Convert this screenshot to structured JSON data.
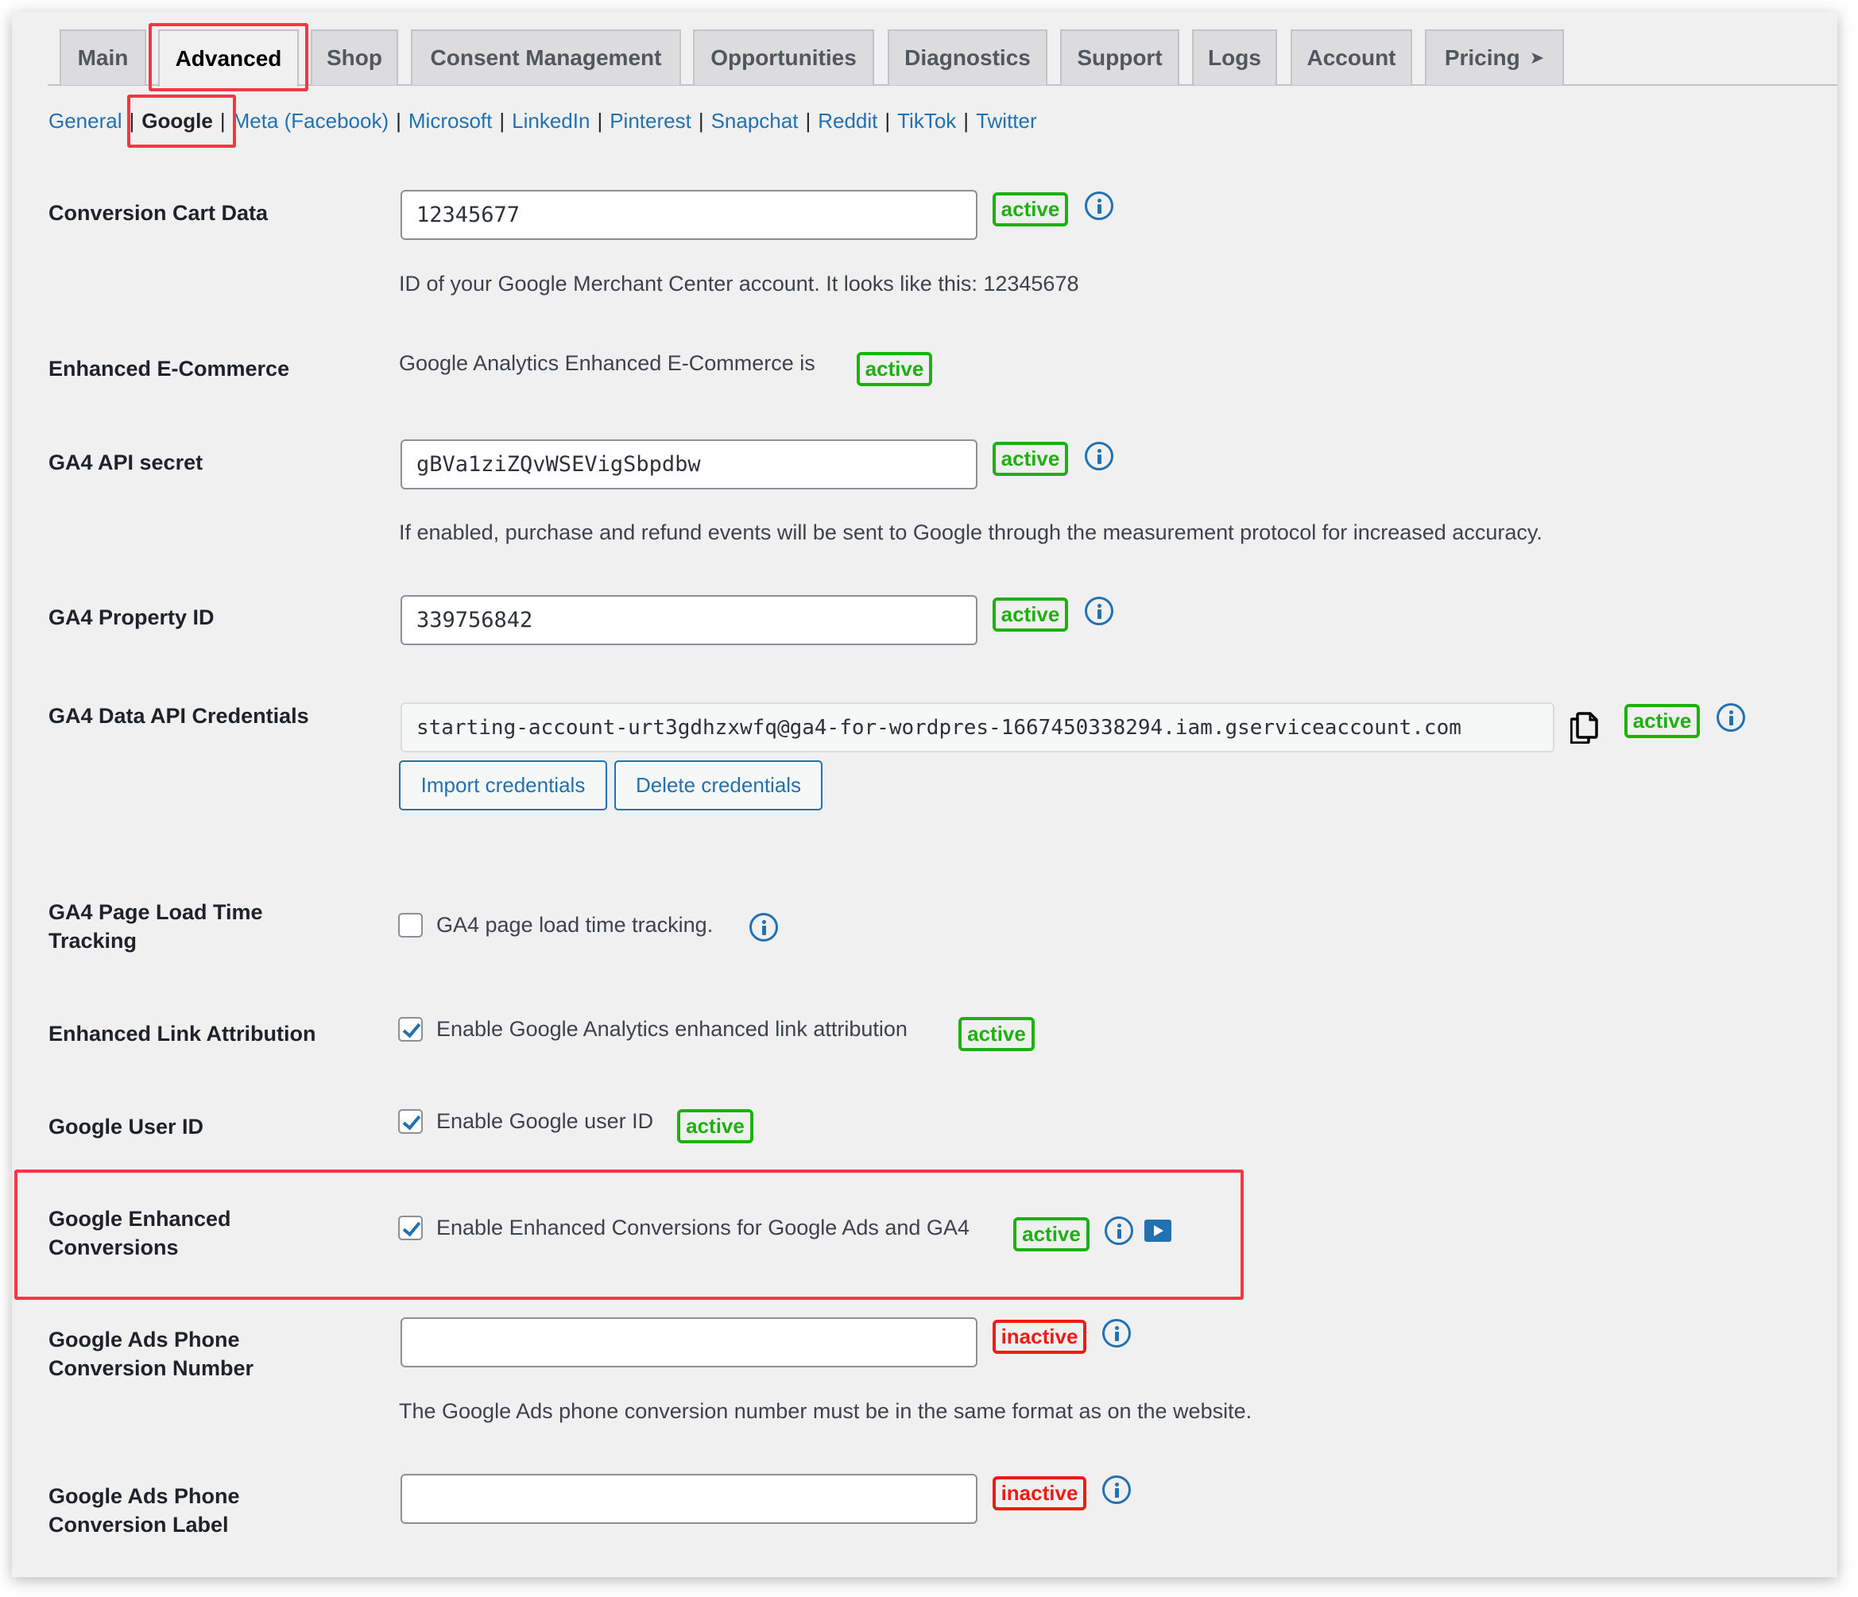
{
  "tabs": [
    {
      "label": "Main",
      "active": false
    },
    {
      "label": "Advanced",
      "active": true
    },
    {
      "label": "Shop",
      "active": false
    },
    {
      "label": "Consent Management",
      "active": false
    },
    {
      "label": "Opportunities",
      "active": false
    },
    {
      "label": "Diagnostics",
      "active": false
    },
    {
      "label": "Support",
      "active": false
    },
    {
      "label": "Logs",
      "active": false
    },
    {
      "label": "Account",
      "active": false
    },
    {
      "label": "Pricing",
      "active": false,
      "icon": "chevron-right-icon",
      "glyph": "➤"
    }
  ],
  "subnav": {
    "separator": "|",
    "items": [
      {
        "label": "General",
        "current": false
      },
      {
        "label": "Google",
        "current": true
      },
      {
        "label": "Meta (Facebook)",
        "current": false
      },
      {
        "label": "Microsoft",
        "current": false
      },
      {
        "label": "LinkedIn",
        "current": false
      },
      {
        "label": "Pinterest",
        "current": false
      },
      {
        "label": "Snapchat",
        "current": false
      },
      {
        "label": "Reddit",
        "current": false
      },
      {
        "label": "TikTok",
        "current": false
      },
      {
        "label": "Twitter",
        "current": false
      }
    ]
  },
  "status": {
    "active": "active",
    "inactive": "inactive",
    "active_color": "#1db10f",
    "inactive_color": "#f01b12"
  },
  "settings": {
    "conversion_cart_data": {
      "label": "Conversion Cart Data",
      "value": "12345677",
      "status": "active",
      "description": "ID of your Google Merchant Center account. It looks like this: 12345678"
    },
    "enhanced_ecommerce": {
      "label": "Enhanced E-Commerce",
      "text": "Google Analytics Enhanced E-Commerce is",
      "status": "active"
    },
    "ga4_api_secret": {
      "label": "GA4 API secret",
      "value": "gBVa1ziZQvWSEVigSbpdbw",
      "status": "active",
      "description": "If enabled, purchase and refund events will be sent to Google through the measurement protocol for increased accuracy."
    },
    "ga4_property_id": {
      "label": "GA4 Property ID",
      "value": "339756842",
      "status": "active"
    },
    "ga4_data_api_credentials": {
      "label": "GA4 Data API Credentials",
      "value": "starting-account-urt3gdhzxwfq@ga4-for-wordpres-1667450338294.iam.gserviceaccount.com",
      "status": "active",
      "import_button": "Import credentials",
      "delete_button": "Delete credentials"
    },
    "ga4_page_load_time": {
      "label_line1": "GA4 Page Load Time",
      "label_line2": "Tracking",
      "checkbox_label": "GA4 page load time tracking.",
      "checked": false
    },
    "enhanced_link_attribution": {
      "label": "Enhanced Link Attribution",
      "checkbox_label": "Enable Google Analytics enhanced link attribution",
      "checked": true,
      "status": "active"
    },
    "google_user_id": {
      "label": "Google User ID",
      "checkbox_label": "Enable Google user ID",
      "checked": true,
      "status": "active"
    },
    "google_enhanced_conversions": {
      "label_line1": "Google Enhanced",
      "label_line2": "Conversions",
      "checkbox_label": "Enable Enhanced Conversions for Google Ads and GA4",
      "checked": true,
      "status": "active"
    },
    "google_ads_phone_conversion_number": {
      "label_line1": "Google Ads Phone",
      "label_line2": "Conversion Number",
      "value": "",
      "status": "inactive",
      "description": "The Google Ads phone conversion number must be in the same format as on the website."
    },
    "google_ads_phone_conversion_label": {
      "label_line1": "Google Ads Phone",
      "label_line2": "Conversion Label",
      "value": "",
      "status": "inactive"
    }
  },
  "annotation_color": "#f73645"
}
